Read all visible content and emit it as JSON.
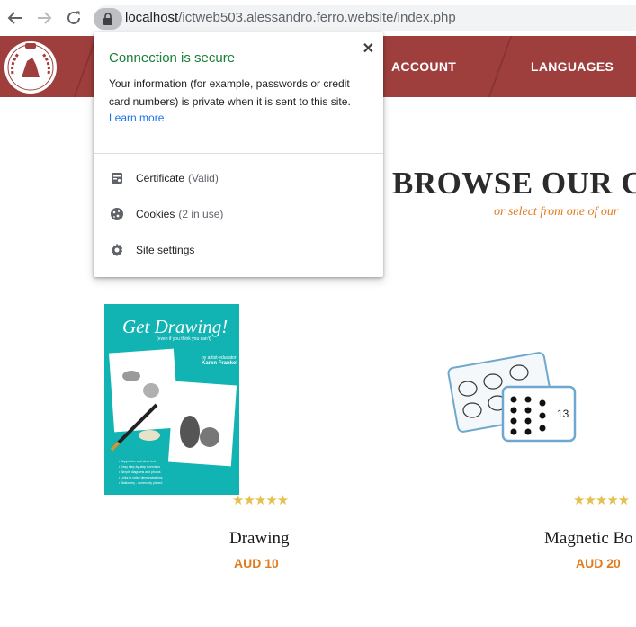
{
  "browser": {
    "url_host": "localhost",
    "url_path": "/ictweb503.alessandro.ferro.website/index.php"
  },
  "header": {
    "nav": [
      "ACCOUNT",
      "LANGUAGES"
    ]
  },
  "main": {
    "headline": "BROWSE OUR C",
    "subline": "or select from one of our"
  },
  "products": [
    {
      "name": "Drawing",
      "price": "AUD 10",
      "stars": "★★★★★",
      "cover_title": "Get Drawing!",
      "cover_subtitle": "(even if you think you can't)",
      "cover_by": "by artist-educator",
      "cover_author": "Karen Frankel"
    },
    {
      "name": "Magnetic Bo",
      "price": "AUD 20",
      "stars": "★★★★★",
      "card_number": "13"
    }
  ],
  "popup": {
    "title": "Connection is secure",
    "description": "Your information (for example, passwords or credit card numbers) is private when it is sent to this site.",
    "learn_more": "Learn more",
    "close": "✕",
    "rows": [
      {
        "label": "Certificate",
        "note": "(Valid)",
        "icon": "certificate-icon"
      },
      {
        "label": "Cookies",
        "note": "(2 in use)",
        "icon": "cookie-icon"
      },
      {
        "label": "Site settings",
        "note": "",
        "icon": "gear-icon"
      }
    ]
  },
  "colors": {
    "header_bg": "#9f3f3d",
    "accent_orange": "#e07b1f",
    "secure_green": "#188038",
    "link_blue": "#1a73e8",
    "book_teal": "#12b3b3"
  }
}
